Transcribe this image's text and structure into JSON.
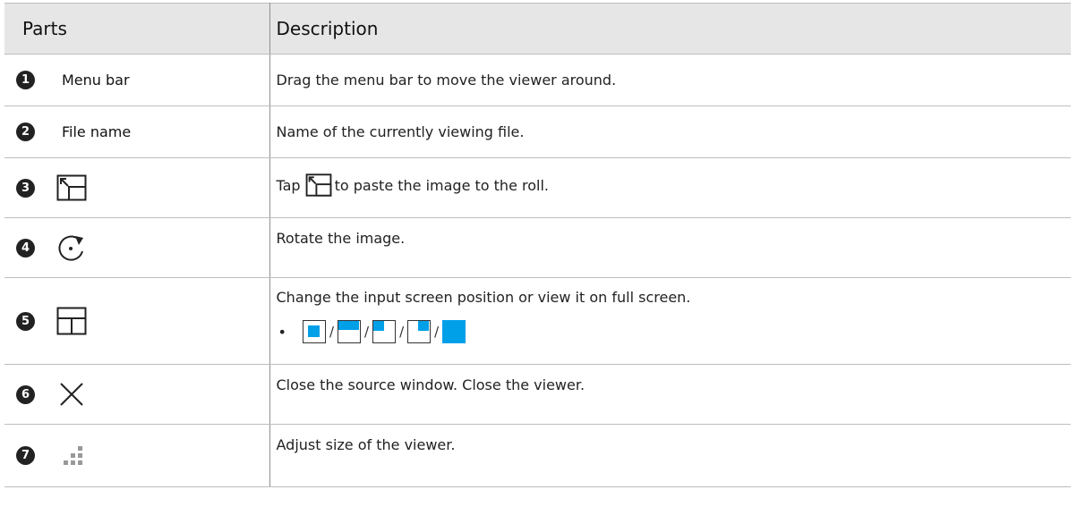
{
  "table": {
    "headers": [
      "Parts",
      "Description"
    ],
    "rows": [
      {
        "number": "1",
        "part_label": "Menu bar",
        "part_icon": "",
        "description": "Drag the menu bar to move the viewer around."
      },
      {
        "number": "2",
        "part_label": "File name",
        "part_icon": "",
        "description": "Name of the currently viewing file."
      },
      {
        "number": "3",
        "part_label": "",
        "part_icon": "paste-to-roll-icon",
        "description_before": "Tap",
        "description_after": "to paste the image to the roll."
      },
      {
        "number": "4",
        "part_label": "",
        "part_icon": "rotate-icon",
        "description": "Rotate the image."
      },
      {
        "number": "5",
        "part_label": "",
        "part_icon": "layout-icon",
        "description": "Change the input screen position or view it on full screen.",
        "bullet": "•",
        "separator": "/",
        "modes": [
          "center-box",
          "top-half",
          "top-left-quarter",
          "top-right-quarter",
          "full-screen"
        ]
      },
      {
        "number": "6",
        "part_label": "",
        "part_icon": "close-icon",
        "description": "Close the source window. Close the viewer."
      },
      {
        "number": "7",
        "part_label": "",
        "part_icon": "resize-handle-icon",
        "description": "Adjust size of the viewer."
      }
    ]
  },
  "colors": {
    "header_bg": "#e6e6e6",
    "badge": "#222222",
    "accent_fill": "#00a0e9"
  }
}
